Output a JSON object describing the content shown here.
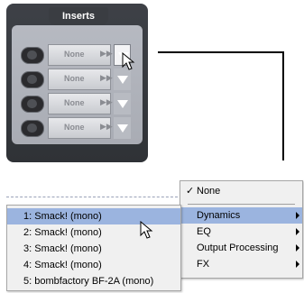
{
  "inserts_panel": {
    "title": "Inserts",
    "slots": [
      {
        "name": "None",
        "arrows": "▶▶"
      },
      {
        "name": "None",
        "arrows": "▶▶"
      },
      {
        "name": "None",
        "arrows": "▶▶"
      },
      {
        "name": "None",
        "arrows": "▶▶"
      }
    ]
  },
  "category_menu": {
    "checked_item": {
      "check": "✓",
      "label": "None"
    },
    "items": [
      {
        "label": "Dynamics",
        "highlighted": true
      },
      {
        "label": "EQ",
        "highlighted": false
      },
      {
        "label": "Output Processing",
        "highlighted": false
      },
      {
        "label": "FX",
        "highlighted": false
      }
    ]
  },
  "plugin_menu": {
    "items": [
      {
        "label": "1: Smack! (mono)",
        "highlighted": true
      },
      {
        "label": "2: Smack! (mono)",
        "highlighted": false
      },
      {
        "label": "3: Smack! (mono)",
        "highlighted": false
      },
      {
        "label": "4: Smack! (mono)",
        "highlighted": false
      },
      {
        "label": "5: bombfactory BF-2A (mono)",
        "highlighted": false
      }
    ]
  },
  "colors": {
    "panel_dark": "#3a3d42",
    "menu_bg": "#f0f0f0",
    "menu_highlight": "#9bb4df"
  }
}
